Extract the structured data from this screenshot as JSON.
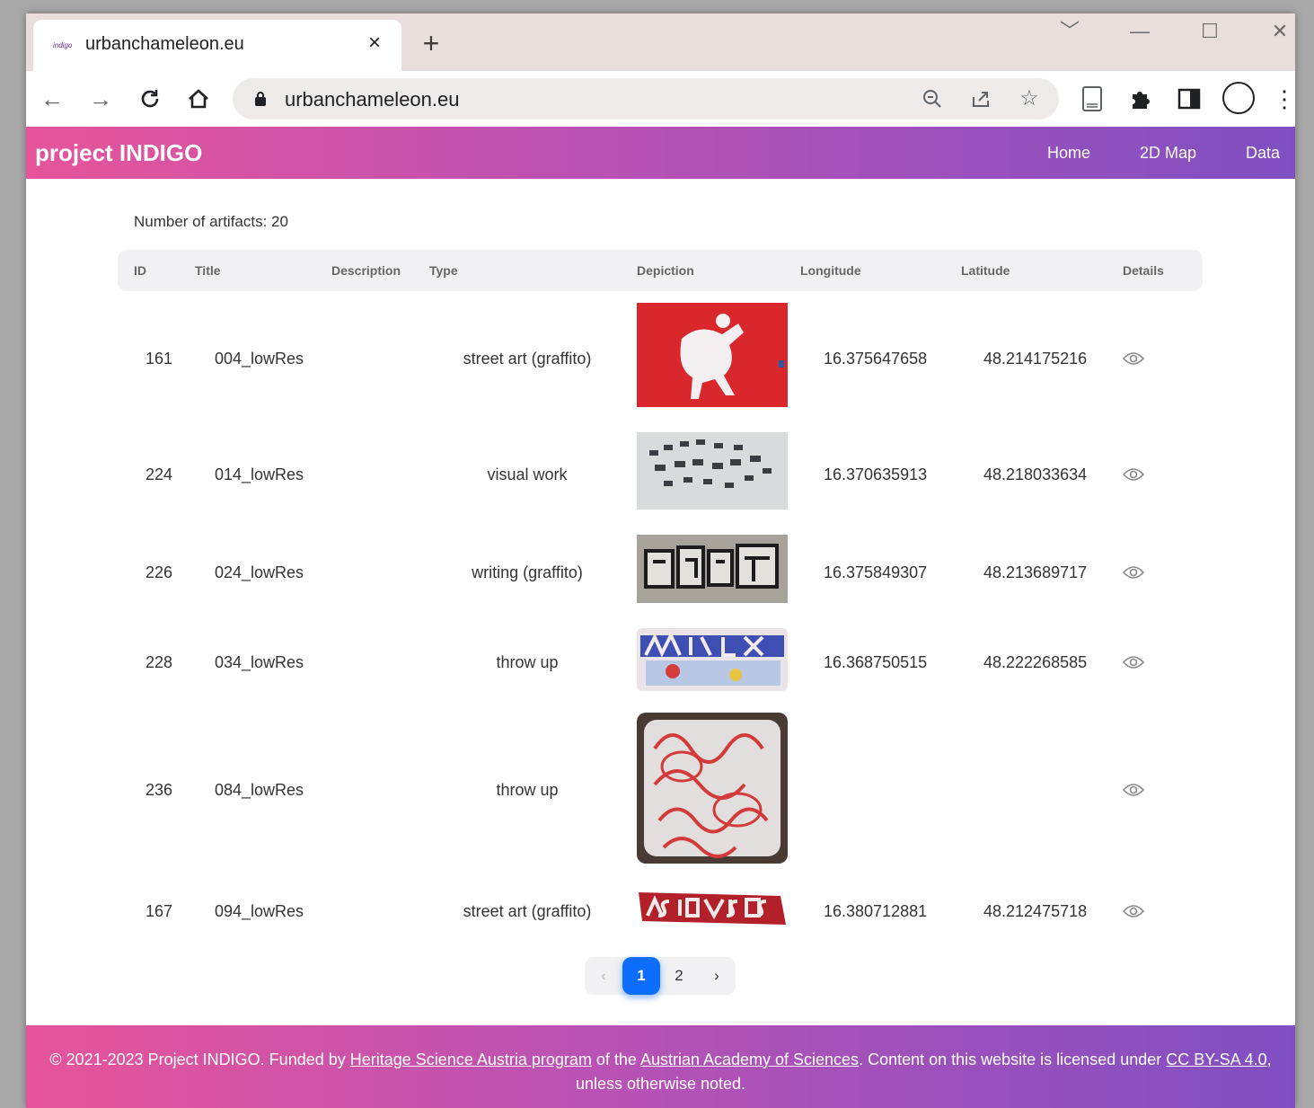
{
  "browser": {
    "tab_title": "urbanchameleon.eu",
    "tab_favicon": "indigo",
    "tab_close_icon": "×",
    "new_tab_icon": "+",
    "url": "urbanchameleon.eu",
    "window_controls": [
      "﹀",
      "—",
      "☐",
      "✕"
    ]
  },
  "site": {
    "brand": "project INDIGO",
    "nav": [
      "Home",
      "2D Map",
      "Data"
    ]
  },
  "main": {
    "count_text": "Number of artifacts: 20",
    "columns": [
      "ID",
      "Title",
      "Description",
      "Type",
      "Depiction",
      "Longitude",
      "Latitude",
      "Details"
    ],
    "rows": [
      {
        "id": "161",
        "title": "004_lowRes",
        "description": "",
        "type": "street art (graffito)",
        "longitude": "16.375647658",
        "latitude": "48.214175216"
      },
      {
        "id": "224",
        "title": "014_lowRes",
        "description": "",
        "type": "visual work",
        "longitude": "16.370635913",
        "latitude": "48.218033634"
      },
      {
        "id": "226",
        "title": "024_lowRes",
        "description": "",
        "type": "writing (graffito)",
        "longitude": "16.375849307",
        "latitude": "48.213689717"
      },
      {
        "id": "228",
        "title": "034_lowRes",
        "description": "",
        "type": "throw up",
        "longitude": "16.368750515",
        "latitude": "48.222268585"
      },
      {
        "id": "236",
        "title": "084_lowRes",
        "description": "",
        "type": "throw up",
        "longitude": "",
        "latitude": ""
      },
      {
        "id": "167",
        "title": "094_lowRes",
        "description": "",
        "type": "street art (graffito)",
        "longitude": "16.380712881",
        "latitude": "48.212475718"
      }
    ]
  },
  "pagination": {
    "prev": "‹",
    "pages": [
      "1",
      "2"
    ],
    "current": "1",
    "next": "›"
  },
  "footer": {
    "prefix": "© 2021-2023 Project INDIGO. Funded by ",
    "link1": "Heritage Science Austria program",
    "mid1": " of the ",
    "link2": "Austrian Academy of Sciences",
    "mid2": ". Content on this website is licensed under ",
    "link3": "CC BY-SA 4.0",
    "suffix": ", unless otherwise noted."
  },
  "colors": {
    "gradient_start": "#e6549a",
    "gradient_end": "#7f4fc2",
    "pager_active": "#0d6efd"
  }
}
